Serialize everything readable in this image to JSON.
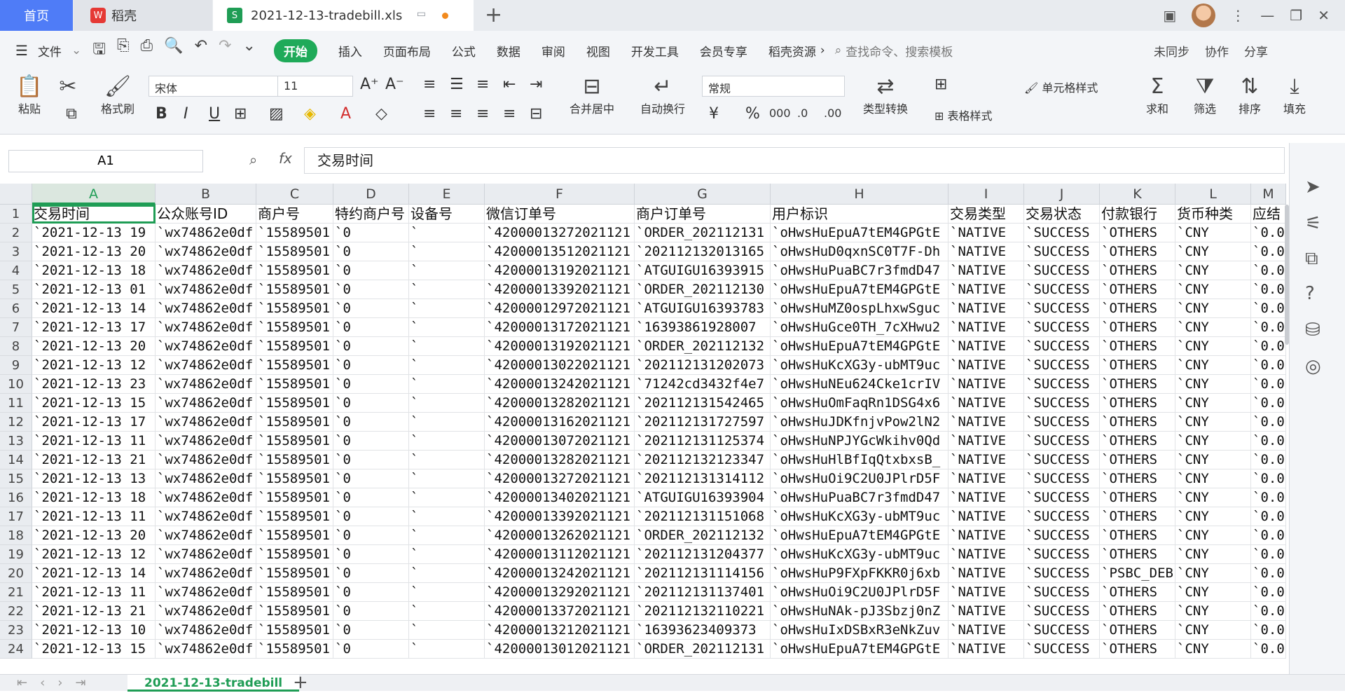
{
  "titlebar": {
    "home_tab": "首页",
    "doc_tab": "稻壳",
    "file_tab": "2021-12-13-tradebill.xls",
    "new_tab": "+"
  },
  "menubar": {
    "file": "文件",
    "items": [
      "开始",
      "插入",
      "页面布局",
      "公式",
      "数据",
      "审阅",
      "视图",
      "开发工具",
      "会员专享",
      "稻壳资源"
    ],
    "search_placeholder": "查找命令、搜索模板",
    "sync": "未同步",
    "collab": "协作",
    "share": "分享"
  },
  "ribbon": {
    "paste": "粘贴",
    "format_painter": "格式刷",
    "font_name": "宋体",
    "font_size": "11",
    "merge": "合并居中",
    "wrap": "自动换行",
    "number_format": "常规",
    "convert": "类型转换",
    "cell_style": "单元格样式",
    "table_style": "表格样式",
    "sum": "求和",
    "filter": "筛选",
    "sort": "排序",
    "fill": "填充"
  },
  "formula_bar": {
    "name_box": "A1",
    "fx": "fx",
    "content": "交易时间"
  },
  "columns": [
    "A",
    "B",
    "C",
    "D",
    "E",
    "F",
    "G",
    "H",
    "I",
    "J",
    "K",
    "L",
    "M"
  ],
  "header_row": [
    "交易时间",
    "公众账号ID",
    "商户号",
    "特约商户号",
    "设备号",
    "微信订单号",
    "商户订单号",
    "用户标识",
    "交易类型",
    "交易状态",
    "付款银行",
    "货币种类",
    "应结"
  ],
  "rows": [
    {
      "n": "2",
      "a": "`2021-12-13 19",
      "f": "`42000013272021121",
      "g": "`ORDER_202112131",
      "h": "`oHwsHuEpuA7tEM4GPGtE",
      "k": "`OTHERS"
    },
    {
      "n": "3",
      "a": "`2021-12-13 20",
      "f": "`42000013512021121",
      "g": "`202112132013165",
      "h": "`oHwsHuD0qxnSC0T7F-Dh",
      "k": "`OTHERS"
    },
    {
      "n": "4",
      "a": "`2021-12-13 18",
      "f": "`42000013192021121",
      "g": "`ATGUIGU16393915",
      "h": "`oHwsHuPuaBC7r3fmdD47",
      "k": "`OTHERS"
    },
    {
      "n": "5",
      "a": "`2021-12-13 01",
      "f": "`42000013392021121",
      "g": "`ORDER_202112130",
      "h": "`oHwsHuEpuA7tEM4GPGtE",
      "k": "`OTHERS"
    },
    {
      "n": "6",
      "a": "`2021-12-13 14",
      "f": "`42000012972021121",
      "g": "`ATGUIGU16393783",
      "h": "`oHwsHuMZ0ospLhxwSguc",
      "k": "`OTHERS"
    },
    {
      "n": "7",
      "a": "`2021-12-13 17",
      "f": "`42000013172021121",
      "g": "`16393861928007",
      "h": "`oHwsHuGce0TH_7cXHwu2",
      "k": "`OTHERS"
    },
    {
      "n": "8",
      "a": "`2021-12-13 20",
      "f": "`42000013192021121",
      "g": "`ORDER_202112132",
      "h": "`oHwsHuEpuA7tEM4GPGtE",
      "k": "`OTHERS"
    },
    {
      "n": "9",
      "a": "`2021-12-13 12",
      "f": "`42000013022021121",
      "g": "`202112131202073",
      "h": "`oHwsHuKcXG3y-ubMT9uc",
      "k": "`OTHERS"
    },
    {
      "n": "10",
      "a": "`2021-12-13 23",
      "f": "`42000013242021121",
      "g": "`71242cd3432f4e7",
      "h": "`oHwsHuNEu624Cke1crIV",
      "k": "`OTHERS"
    },
    {
      "n": "11",
      "a": "`2021-12-13 15",
      "f": "`42000013282021121",
      "g": "`202112131542465",
      "h": "`oHwsHuOmFaqRn1DSG4x6",
      "k": "`OTHERS"
    },
    {
      "n": "12",
      "a": "`2021-12-13 17",
      "f": "`42000013162021121",
      "g": "`202112131727597",
      "h": "`oHwsHuJDKfnjvPow2lN2",
      "k": "`OTHERS"
    },
    {
      "n": "13",
      "a": "`2021-12-13 11",
      "f": "`42000013072021121",
      "g": "`202112131125374",
      "h": "`oHwsHuNPJYGcWkihv0Qd",
      "k": "`OTHERS"
    },
    {
      "n": "14",
      "a": "`2021-12-13 21",
      "f": "`42000013282021121",
      "g": "`202112132123347",
      "h": "`oHwsHuHlBfIqQtxbxsB_",
      "k": "`OTHERS"
    },
    {
      "n": "15",
      "a": "`2021-12-13 13",
      "f": "`42000013272021121",
      "g": "`202112131314112",
      "h": "`oHwsHuOi9C2U0JPlrD5F",
      "k": "`OTHERS"
    },
    {
      "n": "16",
      "a": "`2021-12-13 18",
      "f": "`42000013402021121",
      "g": "`ATGUIGU16393904",
      "h": "`oHwsHuPuaBC7r3fmdD47",
      "k": "`OTHERS"
    },
    {
      "n": "17",
      "a": "`2021-12-13 11",
      "f": "`42000013392021121",
      "g": "`202112131151068",
      "h": "`oHwsHuKcXG3y-ubMT9uc",
      "k": "`OTHERS"
    },
    {
      "n": "18",
      "a": "`2021-12-13 20",
      "f": "`42000013262021121",
      "g": "`ORDER_202112132",
      "h": "`oHwsHuEpuA7tEM4GPGtE",
      "k": "`OTHERS"
    },
    {
      "n": "19",
      "a": "`2021-12-13 12",
      "f": "`42000013112021121",
      "g": "`202112131204377",
      "h": "`oHwsHuKcXG3y-ubMT9uc",
      "k": "`OTHERS"
    },
    {
      "n": "20",
      "a": "`2021-12-13 14",
      "f": "`42000013242021121",
      "g": "`202112131114156",
      "h": "`oHwsHuP9FXpFKKR0j6xb",
      "k": "`PSBC_DEB"
    },
    {
      "n": "21",
      "a": "`2021-12-13 11",
      "f": "`42000013292021121",
      "g": "`202112131137401",
      "h": "`oHwsHuOi9C2U0JPlrD5F",
      "k": "`OTHERS"
    },
    {
      "n": "22",
      "a": "`2021-12-13 21",
      "f": "`42000013372021121",
      "g": "`202112132110221",
      "h": "`oHwsHuNAk-pJ3Sbzj0nZ",
      "k": "`OTHERS"
    },
    {
      "n": "23",
      "a": "`2021-12-13 10",
      "f": "`42000013212021121",
      "g": "`16393623409373",
      "h": "`oHwsHuIxDSBxR3eNkZuv",
      "k": "`OTHERS"
    },
    {
      "n": "24",
      "a": "`2021-12-13 15",
      "f": "`42000013012021121",
      "g": "`ORDER_202112131",
      "h": "`oHwsHuEpuA7tEM4GPGtE",
      "k": "`OTHERS"
    }
  ],
  "common": {
    "b": "`wx74862e0df",
    "c": "`15589501",
    "d": "`0",
    "e": "`",
    "i": "`NATIVE",
    "j": "`SUCCESS",
    "l": "`CNY",
    "m": "`0.0"
  },
  "sheet": {
    "name": "2021-12-13-tradebill",
    "add": "+"
  },
  "accent": "#1f9d55"
}
